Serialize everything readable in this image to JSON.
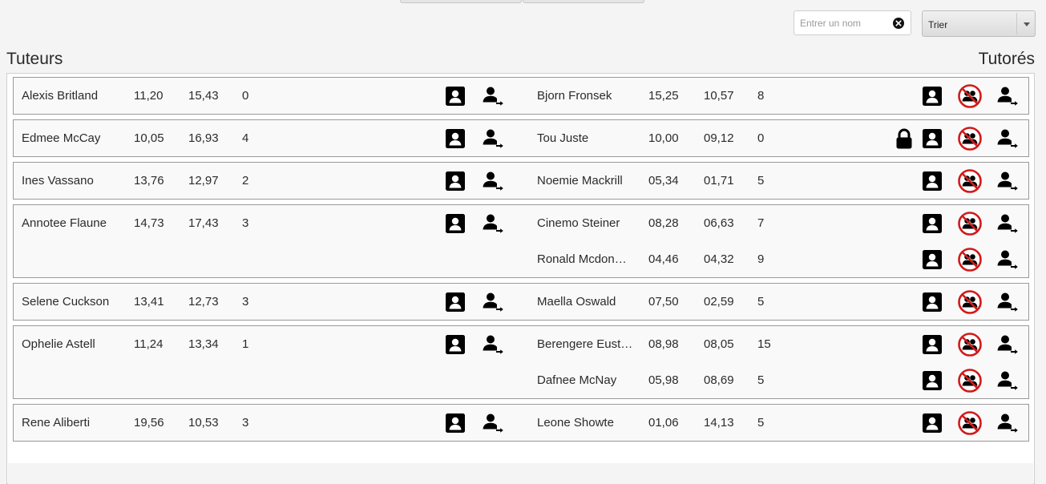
{
  "search": {
    "placeholder": "Entrer un nom",
    "value": ""
  },
  "sort": {
    "selected": "Trier"
  },
  "headers": {
    "tutors": "Tuteurs",
    "tutees": "Tutorés"
  },
  "colors": {
    "unlink_red": "#d11a1a",
    "icon_black": "#000000",
    "card_border": "#9a9a9a"
  },
  "icons": {
    "tutor_profile": "contact-card-icon",
    "tutor_move": "person-arrow-icon",
    "tutee_profile": "contact-card-icon",
    "tutee_unlink": "no-pair-icon",
    "tutee_move": "person-arrow-icon",
    "lock": "lock-icon"
  },
  "pairs": [
    {
      "tutor": {
        "name": "Alexis Britland",
        "v1": "11,20",
        "v2": "15,43",
        "v3": "0"
      },
      "tutees": [
        {
          "name": "Bjorn Fronsek",
          "v1": "15,25",
          "v2": "10,57",
          "v3": "8",
          "locked": false
        }
      ]
    },
    {
      "tutor": {
        "name": "Edmee McCay",
        "v1": "10,05",
        "v2": "16,93",
        "v3": "4"
      },
      "tutees": [
        {
          "name": "Tou Juste",
          "v1": "10,00",
          "v2": "09,12",
          "v3": "0",
          "locked": true
        }
      ]
    },
    {
      "tutor": {
        "name": "Ines Vassano",
        "v1": "13,76",
        "v2": "12,97",
        "v3": "2"
      },
      "tutees": [
        {
          "name": "Noemie Mackrill",
          "v1": "05,34",
          "v2": "01,71",
          "v3": "5",
          "locked": false
        }
      ]
    },
    {
      "tutor": {
        "name": "Annotee Flaune",
        "v1": "14,73",
        "v2": "17,43",
        "v3": "3"
      },
      "tutees": [
        {
          "name": "Cinemo Steiner",
          "v1": "08,28",
          "v2": "06,63",
          "v3": "7",
          "locked": false
        },
        {
          "name": "Ronald Mcdon…",
          "v1": "04,46",
          "v2": "04,32",
          "v3": "9",
          "locked": false
        }
      ]
    },
    {
      "tutor": {
        "name": "Selene Cuckson",
        "v1": "13,41",
        "v2": "12,73",
        "v3": "3"
      },
      "tutees": [
        {
          "name": "Maella Oswald",
          "v1": "07,50",
          "v2": "02,59",
          "v3": "5",
          "locked": false
        }
      ]
    },
    {
      "tutor": {
        "name": "Ophelie Astell",
        "v1": "11,24",
        "v2": "13,34",
        "v3": "1"
      },
      "tutees": [
        {
          "name": "Berengere Eust…",
          "v1": "08,98",
          "v2": "08,05",
          "v3": "15",
          "locked": false
        },
        {
          "name": "Dafnee McNay",
          "v1": "05,98",
          "v2": "08,69",
          "v3": "5",
          "locked": false
        }
      ]
    },
    {
      "tutor": {
        "name": "Rene Aliberti",
        "v1": "19,56",
        "v2": "10,53",
        "v3": "3"
      },
      "tutees": [
        {
          "name": "Leone Showte",
          "v1": "01,06",
          "v2": "14,13",
          "v3": "5",
          "locked": false
        }
      ]
    }
  ]
}
